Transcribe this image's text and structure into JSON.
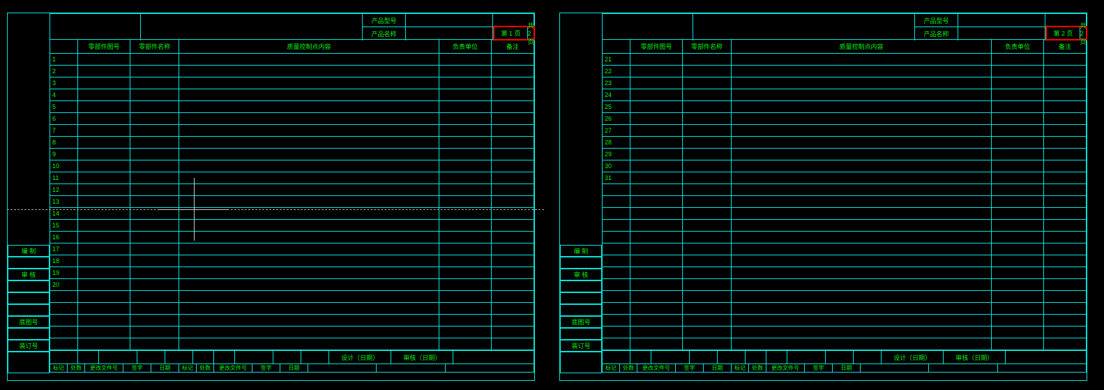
{
  "header": {
    "product_model_label": "产品型号",
    "product_name_label": "产品名称"
  },
  "pages": [
    {
      "page_label": "第 1 页",
      "total_label": "共 2 页"
    },
    {
      "page_label": "第 2 页",
      "total_label": "共 2 页"
    }
  ],
  "columns": {
    "serial": "",
    "part_no": "零部件图号",
    "part_name": "零部件名称",
    "qc_content": "质量控制点内容",
    "dept": "负责单位",
    "note": "备注"
  },
  "rows_left": [
    "1",
    "2",
    "3",
    "4",
    "5",
    "6",
    "7",
    "8",
    "9",
    "10",
    "11",
    "12",
    "13",
    "14",
    "15",
    "16",
    "17",
    "18",
    "19",
    "20"
  ],
  "rows_right": [
    "21",
    "22",
    "23",
    "24",
    "25",
    "26",
    "27",
    "28",
    "29",
    "30",
    "31",
    "",
    "",
    "",
    "",
    "",
    "",
    "",
    "",
    ""
  ],
  "left_labels": {
    "compile": "编 制",
    "review": "审 核",
    "dwg_no": "底图号",
    "file_no": "装订号"
  },
  "footer1": {
    "f_a": "",
    "f_b": "",
    "design_date": "设计（日期）",
    "check_date": "审核（日期）"
  },
  "footer2": {
    "mark": "标记",
    "qty": "处数",
    "change_no": "更改文件号",
    "sign": "签字",
    "date": "日期"
  }
}
